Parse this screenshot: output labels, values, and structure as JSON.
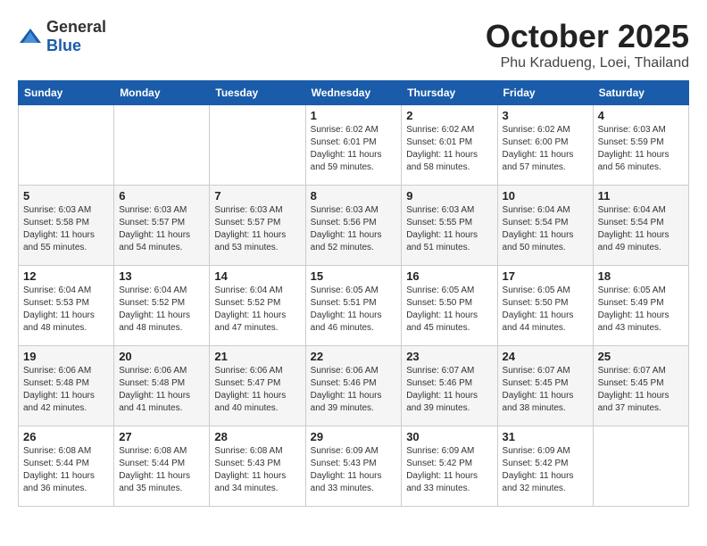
{
  "header": {
    "logo_general": "General",
    "logo_blue": "Blue",
    "month": "October 2025",
    "location": "Phu Kradueng, Loei, Thailand"
  },
  "weekdays": [
    "Sunday",
    "Monday",
    "Tuesday",
    "Wednesday",
    "Thursday",
    "Friday",
    "Saturday"
  ],
  "weeks": [
    [
      {
        "day": "",
        "info": ""
      },
      {
        "day": "",
        "info": ""
      },
      {
        "day": "",
        "info": ""
      },
      {
        "day": "1",
        "info": "Sunrise: 6:02 AM\nSunset: 6:01 PM\nDaylight: 11 hours\nand 59 minutes."
      },
      {
        "day": "2",
        "info": "Sunrise: 6:02 AM\nSunset: 6:01 PM\nDaylight: 11 hours\nand 58 minutes."
      },
      {
        "day": "3",
        "info": "Sunrise: 6:02 AM\nSunset: 6:00 PM\nDaylight: 11 hours\nand 57 minutes."
      },
      {
        "day": "4",
        "info": "Sunrise: 6:03 AM\nSunset: 5:59 PM\nDaylight: 11 hours\nand 56 minutes."
      }
    ],
    [
      {
        "day": "5",
        "info": "Sunrise: 6:03 AM\nSunset: 5:58 PM\nDaylight: 11 hours\nand 55 minutes."
      },
      {
        "day": "6",
        "info": "Sunrise: 6:03 AM\nSunset: 5:57 PM\nDaylight: 11 hours\nand 54 minutes."
      },
      {
        "day": "7",
        "info": "Sunrise: 6:03 AM\nSunset: 5:57 PM\nDaylight: 11 hours\nand 53 minutes."
      },
      {
        "day": "8",
        "info": "Sunrise: 6:03 AM\nSunset: 5:56 PM\nDaylight: 11 hours\nand 52 minutes."
      },
      {
        "day": "9",
        "info": "Sunrise: 6:03 AM\nSunset: 5:55 PM\nDaylight: 11 hours\nand 51 minutes."
      },
      {
        "day": "10",
        "info": "Sunrise: 6:04 AM\nSunset: 5:54 PM\nDaylight: 11 hours\nand 50 minutes."
      },
      {
        "day": "11",
        "info": "Sunrise: 6:04 AM\nSunset: 5:54 PM\nDaylight: 11 hours\nand 49 minutes."
      }
    ],
    [
      {
        "day": "12",
        "info": "Sunrise: 6:04 AM\nSunset: 5:53 PM\nDaylight: 11 hours\nand 48 minutes."
      },
      {
        "day": "13",
        "info": "Sunrise: 6:04 AM\nSunset: 5:52 PM\nDaylight: 11 hours\nand 48 minutes."
      },
      {
        "day": "14",
        "info": "Sunrise: 6:04 AM\nSunset: 5:52 PM\nDaylight: 11 hours\nand 47 minutes."
      },
      {
        "day": "15",
        "info": "Sunrise: 6:05 AM\nSunset: 5:51 PM\nDaylight: 11 hours\nand 46 minutes."
      },
      {
        "day": "16",
        "info": "Sunrise: 6:05 AM\nSunset: 5:50 PM\nDaylight: 11 hours\nand 45 minutes."
      },
      {
        "day": "17",
        "info": "Sunrise: 6:05 AM\nSunset: 5:50 PM\nDaylight: 11 hours\nand 44 minutes."
      },
      {
        "day": "18",
        "info": "Sunrise: 6:05 AM\nSunset: 5:49 PM\nDaylight: 11 hours\nand 43 minutes."
      }
    ],
    [
      {
        "day": "19",
        "info": "Sunrise: 6:06 AM\nSunset: 5:48 PM\nDaylight: 11 hours\nand 42 minutes."
      },
      {
        "day": "20",
        "info": "Sunrise: 6:06 AM\nSunset: 5:48 PM\nDaylight: 11 hours\nand 41 minutes."
      },
      {
        "day": "21",
        "info": "Sunrise: 6:06 AM\nSunset: 5:47 PM\nDaylight: 11 hours\nand 40 minutes."
      },
      {
        "day": "22",
        "info": "Sunrise: 6:06 AM\nSunset: 5:46 PM\nDaylight: 11 hours\nand 39 minutes."
      },
      {
        "day": "23",
        "info": "Sunrise: 6:07 AM\nSunset: 5:46 PM\nDaylight: 11 hours\nand 39 minutes."
      },
      {
        "day": "24",
        "info": "Sunrise: 6:07 AM\nSunset: 5:45 PM\nDaylight: 11 hours\nand 38 minutes."
      },
      {
        "day": "25",
        "info": "Sunrise: 6:07 AM\nSunset: 5:45 PM\nDaylight: 11 hours\nand 37 minutes."
      }
    ],
    [
      {
        "day": "26",
        "info": "Sunrise: 6:08 AM\nSunset: 5:44 PM\nDaylight: 11 hours\nand 36 minutes."
      },
      {
        "day": "27",
        "info": "Sunrise: 6:08 AM\nSunset: 5:44 PM\nDaylight: 11 hours\nand 35 minutes."
      },
      {
        "day": "28",
        "info": "Sunrise: 6:08 AM\nSunset: 5:43 PM\nDaylight: 11 hours\nand 34 minutes."
      },
      {
        "day": "29",
        "info": "Sunrise: 6:09 AM\nSunset: 5:43 PM\nDaylight: 11 hours\nand 33 minutes."
      },
      {
        "day": "30",
        "info": "Sunrise: 6:09 AM\nSunset: 5:42 PM\nDaylight: 11 hours\nand 33 minutes."
      },
      {
        "day": "31",
        "info": "Sunrise: 6:09 AM\nSunset: 5:42 PM\nDaylight: 11 hours\nand 32 minutes."
      },
      {
        "day": "",
        "info": ""
      }
    ]
  ]
}
